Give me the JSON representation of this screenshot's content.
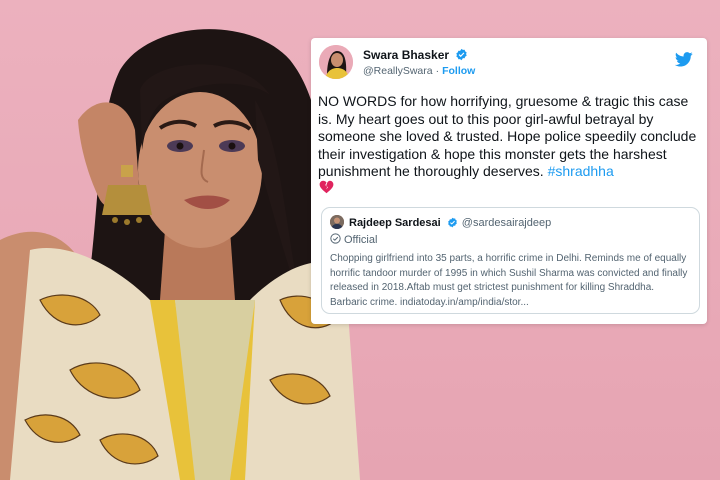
{
  "tweet": {
    "author_name": "Swara Bhasker",
    "author_handle": "@ReallySwara",
    "separator": "·",
    "follow_label": "Follow",
    "text": "NO WORDS for how horrifying, gruesome & tragic this case is. My heart goes out to this poor girl-awful betrayal by someone she loved & trusted. Hope police speedily conclude their investigation & hope this monster gets the harshest punishment he thoroughly deserves. ",
    "hashtag": "#shradhha",
    "emoji_icon": "broken-heart-icon"
  },
  "quoted_tweet": {
    "author_name": "Rajdeep Sardesai",
    "author_handle": "@sardesairajdeep",
    "badge_label": "Official",
    "text": "Chopping girlfriend into 35 parts, a horrific crime in Delhi. Reminds me of equally horrific tandoor murder of 1995 in which Sushil Sharma was convicted and finally released in 2018.Aftab must get strictest punishment for killing Shraddha. Barbaric crime. indiatoday.in/amp/india/stor..."
  },
  "colors": {
    "background": "#e9aab8",
    "twitter_blue": "#1d9bf0",
    "text_dark": "#0f1419",
    "text_muted": "#536471",
    "broken_heart": "#e0245e"
  }
}
